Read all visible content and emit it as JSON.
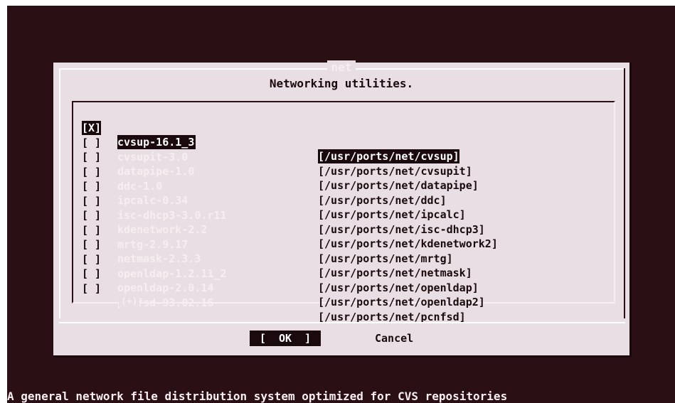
{
  "dialog": {
    "title": "net",
    "subtitle": "Networking utilities."
  },
  "items": [
    {
      "check": "[X]",
      "package": "cvsup-16.1_3",
      "path": "[/usr/ports/net/cvsup]",
      "selected": true
    },
    {
      "check": "[ ]",
      "package": "cvsupit-3.0",
      "path": "[/usr/ports/net/cvsupit]"
    },
    {
      "check": "[ ]",
      "package": "datapipe-1.0",
      "path": "[/usr/ports/net/datapipe]"
    },
    {
      "check": "[ ]",
      "package": "ddc-1.0",
      "path": "[/usr/ports/net/ddc]"
    },
    {
      "check": "[ ]",
      "package": "ipcalc-0.34",
      "path": "[/usr/ports/net/ipcalc]"
    },
    {
      "check": "[ ]",
      "package": "isc-dhcp3-3.0.r11",
      "path": "[/usr/ports/net/isc-dhcp3]"
    },
    {
      "check": "[ ]",
      "package": "kdenetwork-2.2",
      "path": "[/usr/ports/net/kdenetwork2]"
    },
    {
      "check": "[ ]",
      "package": "mrtg-2.9.17",
      "path": "[/usr/ports/net/mrtg]"
    },
    {
      "check": "[ ]",
      "package": "netmask-2.3.3",
      "path": "[/usr/ports/net/netmask]"
    },
    {
      "check": "[ ]",
      "package": "openldap-1.2.11_2",
      "path": "[/usr/ports/net/openldap]"
    },
    {
      "check": "[ ]",
      "package": "openldap-2.0.14",
      "path": "[/usr/ports/net/openldap2]"
    },
    {
      "check": "[ ]",
      "package": "pcnfsd-93.02.16",
      "path": "[/usr/ports/net/pcnfsd]"
    }
  ],
  "list": {
    "more_indicator": "(+)"
  },
  "buttons": {
    "ok_label": "[  OK  ]",
    "cancel_label": "Cancel"
  },
  "status_line": "A general network file distribution system optimized for CVS repositories",
  "colors": {
    "screen_background": "#2a0f14",
    "dialog_background": "#e9dee3",
    "highlight": "#1a0a0d",
    "dim_text": "#f6eef1"
  }
}
